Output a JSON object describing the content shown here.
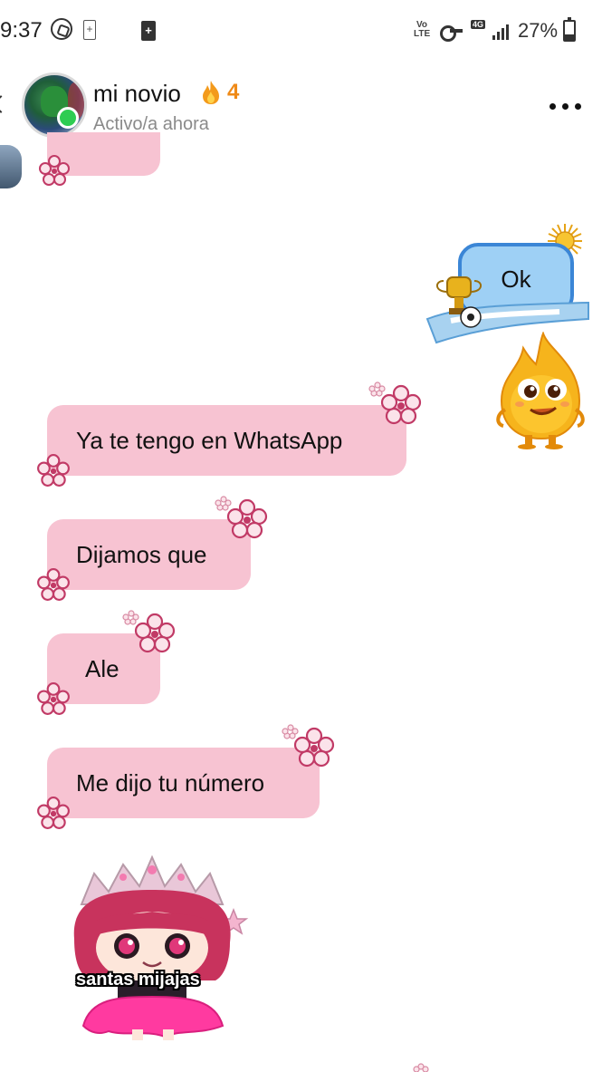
{
  "status_bar": {
    "time": "9:37",
    "volte": "Vo LTE",
    "network": "4G",
    "battery_percent": "27%"
  },
  "header": {
    "contact_name": "mi novio",
    "streak_count": "4",
    "status": "Activo/a ahora"
  },
  "messages": {
    "sent_ok": "Ok",
    "received": [
      "Ya te tengo en WhatsApp",
      "Dijamos que",
      "Ale",
      "Me dijo tu número"
    ]
  },
  "sticker": {
    "caption": "santas mijajas"
  },
  "colors": {
    "bubble_pink": "#f7c3d2",
    "ok_bubble_fill": "#9ed0f5",
    "ok_bubble_border": "#3b86d6",
    "online_green": "#2ecc52",
    "streak_orange": "#ef8a17"
  }
}
